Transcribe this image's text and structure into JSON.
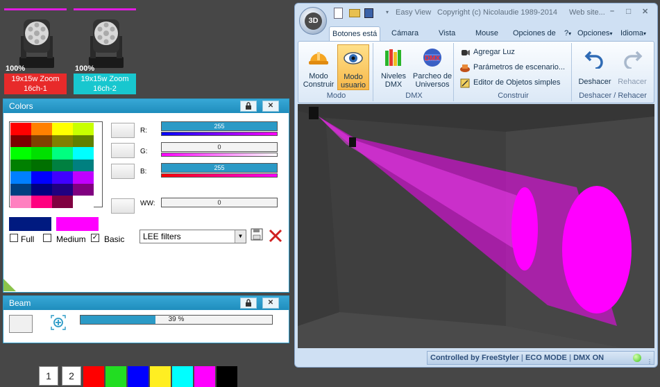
{
  "fixtures": [
    {
      "percent": "100%",
      "name": "19x15w Zoom",
      "channel": "16ch-1",
      "label_color": "#e82a2a"
    },
    {
      "percent": "100%",
      "name": "19x15w Zoom",
      "channel": "16ch-2",
      "label_color": "#18c7cf"
    }
  ],
  "colors_panel": {
    "title": "Colors",
    "r_label": "R:",
    "g_label": "G:",
    "b_label": "B:",
    "ww_label": "WW:",
    "r_value": "255",
    "g_value": "0",
    "b_value": "255",
    "ww_value": "0",
    "full_label": "Full",
    "medium_label": "Medium",
    "basic_label": "Basic",
    "filter_select": "LEE filters",
    "page_1": "1",
    "page_2": "2",
    "basic_colors": [
      "#ff0000",
      "#ff8000",
      "#ffff00",
      "#c8ff00",
      "#7c0000",
      "#804000",
      "#808000",
      "#608000",
      "#00ff00",
      "#00e000",
      "#00ff80",
      "#00ffff",
      "#008000",
      "#007000",
      "#008040",
      "#008080",
      "#0080ff",
      "#0000ff",
      "#4000ff",
      "#c000ff",
      "#004080",
      "#000080",
      "#200080",
      "#800080",
      "#ff80c0",
      "#ff0080",
      "#800040",
      "#ffffff"
    ],
    "quick_colors": [
      "#ff0000",
      "#22dd22",
      "#0000ff",
      "#ffee22",
      "#00ffff",
      "#ff00ff",
      "#000000"
    ]
  },
  "beam_panel": {
    "title": "Beam",
    "value": "39 %",
    "fraction": 0.39
  },
  "app": {
    "quick_title": "Easy View",
    "copyright": "Copyright (c) Nicolaudie 1989-2014",
    "website": "Web site...",
    "logo": "3D",
    "tabs": [
      "Botones está",
      "Cámara",
      "Vista",
      "Mouse",
      "Opciones de"
    ],
    "menu_help": "?",
    "menu_options": "Opciones",
    "menu_language": "Idioma",
    "groups": {
      "mode": "Modo",
      "dmx": "DMX",
      "build": "Construir",
      "undo": "Deshacer / Rehacer"
    },
    "btn_mode_build": [
      "Modo",
      "Construir"
    ],
    "btn_mode_user": [
      "Modo",
      "usuario"
    ],
    "btn_dmx_levels": [
      "Niveles",
      "DMX"
    ],
    "btn_universe": [
      "Parcheo de",
      "Universos"
    ],
    "btn_add_light": "Agregar Luz",
    "btn_scene_params": "Parámetros de escenario...",
    "btn_object_editor": "Editor de Objetos simples",
    "btn_undo": "Deshacer",
    "btn_redo": "Rehacer",
    "status_text": "Controlled by FreeStyler",
    "status_eco": "ECO MODE",
    "status_dmx": "DMX ON"
  }
}
